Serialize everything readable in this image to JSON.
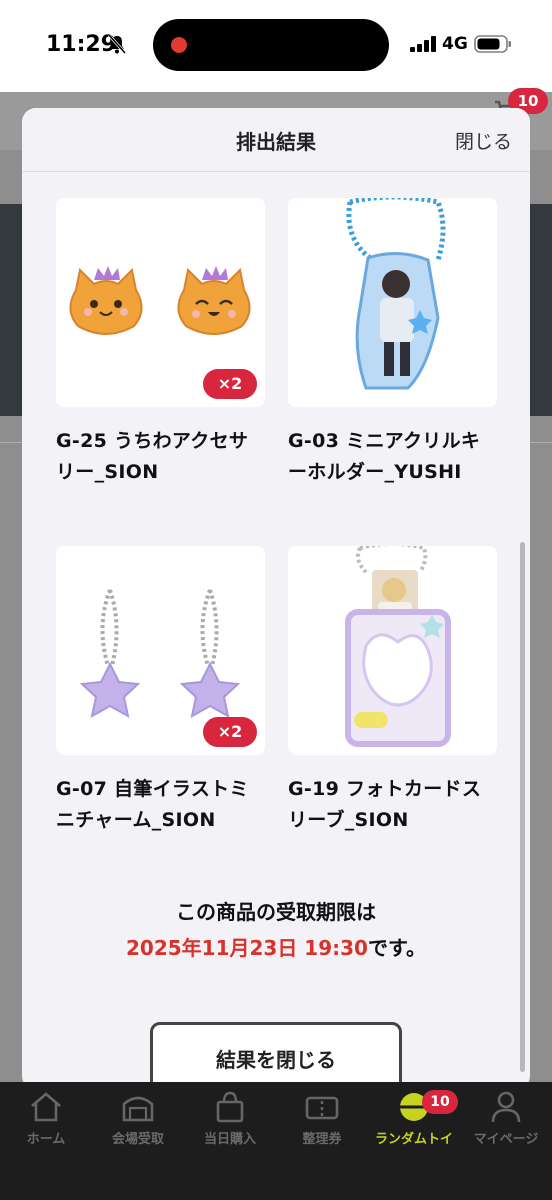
{
  "status_bar": {
    "time": "11:29",
    "network": "4G"
  },
  "background_page": {
    "cart_badge": "10"
  },
  "modal": {
    "title": "排出結果",
    "close_label": "閉じる",
    "items": [
      {
        "name": "G-25 うちわアクセサリー_SION",
        "quantity_badge": "×2",
        "image_icon": "kitten-fan-charm-image"
      },
      {
        "name": "G-03 ミニアクリルキーホルダー_YUSHI",
        "quantity_badge": "",
        "image_icon": "acrylic-keychain-image"
      },
      {
        "name": "G-07 自筆イラストミニチャーム_SION",
        "quantity_badge": "×2",
        "image_icon": "star-charm-image"
      },
      {
        "name": "G-19 フォトカードスリーブ_SION",
        "quantity_badge": "",
        "image_icon": "photocard-sleeve-image"
      }
    ],
    "deadline_text": "この商品の受取期限は",
    "deadline_date": "2025年11月23日 19:30",
    "deadline_suffix": "です。",
    "close_result_button": "結果を閉じる"
  },
  "bottom_nav": {
    "items": [
      {
        "label": "ホーム",
        "icon": "home-icon"
      },
      {
        "label": "会場受取",
        "icon": "venue-icon"
      },
      {
        "label": "当日購入",
        "icon": "shopping-bag-icon"
      },
      {
        "label": "整理券",
        "icon": "ticket-icon"
      },
      {
        "label": "ランダムトイ",
        "icon": "capsule-toy-icon",
        "badge": "10"
      },
      {
        "label": "マイページ",
        "icon": "person-icon"
      }
    ]
  },
  "colors": {
    "accent_red": "#d7263d",
    "deadline_red": "#d9322b",
    "active_nav": "#c6d31e"
  }
}
